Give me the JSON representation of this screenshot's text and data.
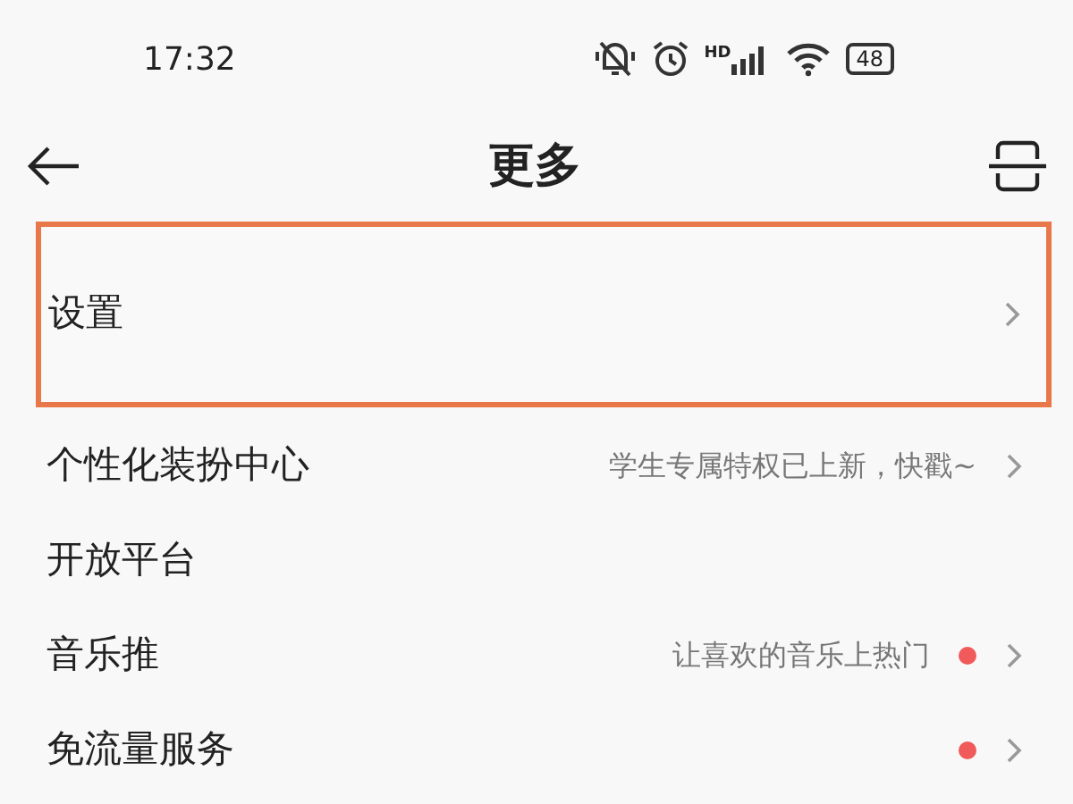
{
  "status_bar": {
    "time": "17:32",
    "network_label": "HD",
    "battery": "48"
  },
  "header": {
    "title": "更多"
  },
  "items": [
    {
      "label": "设置",
      "highlighted": true,
      "chevron": true,
      "dot": false
    },
    {
      "label": "个性化装扮中心",
      "hint": "学生专属特权已上新，快戳~",
      "highlighted": false,
      "chevron": true,
      "dot": false
    },
    {
      "label": "开放平台",
      "highlighted": false,
      "chevron": false,
      "dot": false
    },
    {
      "label": "音乐推",
      "hint": "让喜欢的音乐上热门",
      "highlighted": false,
      "chevron": true,
      "dot": true
    },
    {
      "label": "免流量服务",
      "highlighted": false,
      "chevron": true,
      "dot": true
    }
  ]
}
